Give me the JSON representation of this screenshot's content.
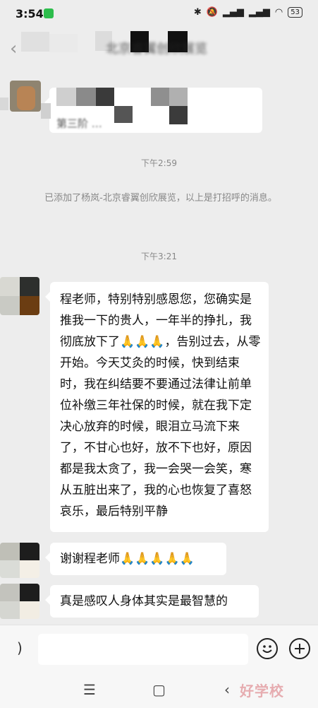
{
  "status_bar": {
    "time": "3:54",
    "icons": [
      "bluetooth-icon",
      "mute-icon",
      "signal-icon",
      "signal-icon",
      "wifi-icon"
    ],
    "battery": "53"
  },
  "header": {
    "title": "北京睿翼创欣展览"
  },
  "messages": [
    {
      "type": "first-message",
      "text": "第三阶 …"
    },
    {
      "type": "timestamp",
      "text": "下午2:59"
    },
    {
      "type": "system",
      "text": "已添加了杨岚-北京睿翼创欣展览，以上是打招呼的消息。"
    },
    {
      "type": "timestamp",
      "text": "下午3:21"
    },
    {
      "type": "received",
      "text": "程老师，特别特别感恩您，您确实是推我一下的贵人，一年半的挣扎，我彻底放下了🙏🙏🙏，告别过去，从零开始。今天艾灸的时候，快到结束时，我在纠结要不要通过法律让前单位补缴三年社保的时候，就在我下定决心放弃的时候，眼泪立马流下来了，不甘心也好，放不下也好，原因都是我太贪了，我一会哭一会笑，寒从五脏出来了，我的心也恢复了喜怒哀乐，最后特别平静"
    },
    {
      "type": "received",
      "text": "谢谢程老师🙏🙏🙏🙏🙏"
    },
    {
      "type": "received",
      "text": "真是感叹人身体其实是最智慧的"
    }
  ],
  "input_bar": {
    "voice_icon": "voice-icon",
    "emoji_icon": "emoji-icon",
    "plus_icon": "plus-icon"
  },
  "nav_bar": {
    "menu_icon": "menu-icon",
    "home_icon": "home-icon",
    "back_icon": "back-icon"
  },
  "watermark": "好学校",
  "colors": {
    "background": "#ededed",
    "bubble": "#ffffff",
    "system_text": "#888888"
  }
}
